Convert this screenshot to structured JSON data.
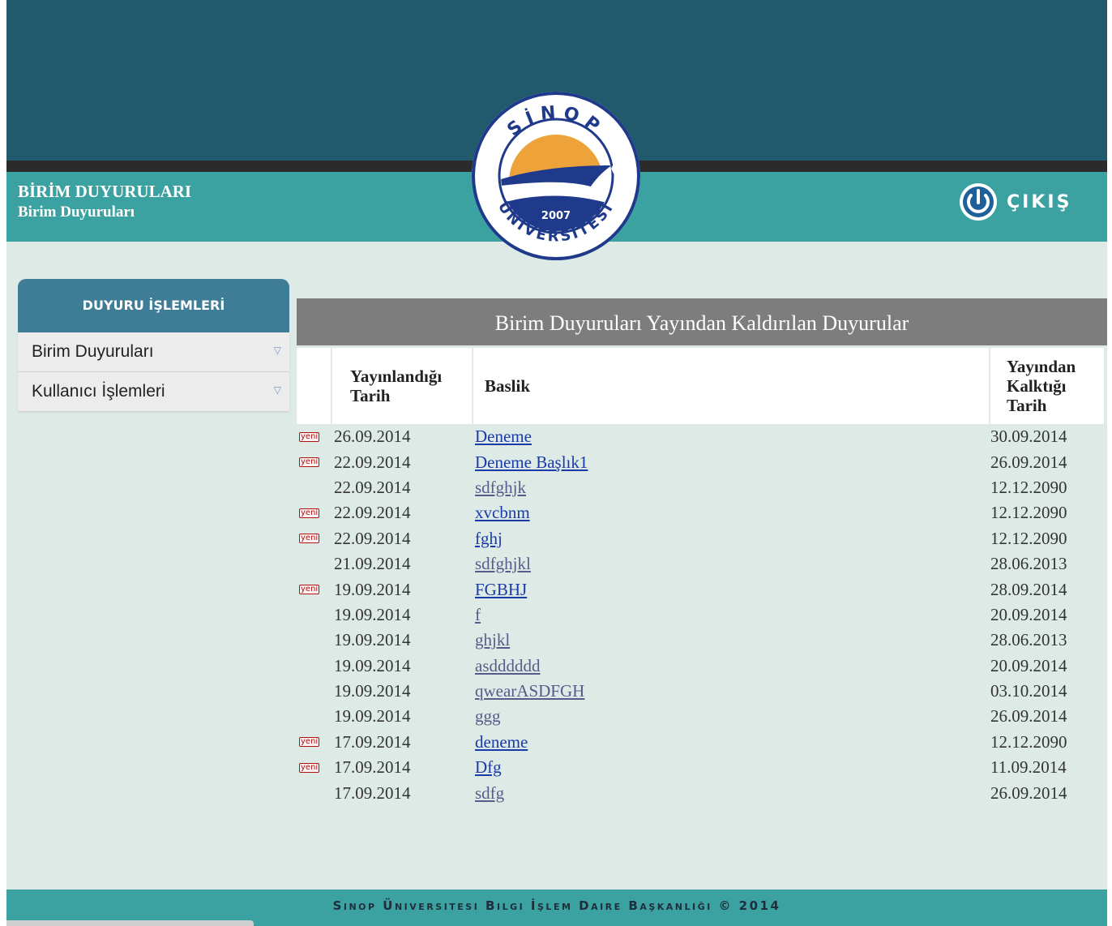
{
  "header": {
    "title": "BİRİM DUYURULARI",
    "subtitle": "Birim Duyuruları",
    "logo": {
      "top_text": "SİNOP",
      "bottom_text": "ÜNİVERSİTESİ",
      "year": "2007"
    },
    "logout_label": "ÇIKIŞ"
  },
  "sidebar": {
    "heading": "DUYURU İŞLEMLERİ",
    "items": [
      {
        "label": "Birim Duyuruları"
      },
      {
        "label": "Kullanıcı İşlemleri"
      }
    ]
  },
  "panel": {
    "title": "Birim Duyuruları Yayından Kaldırılan Duyurular",
    "columns": {
      "published": "Yayınlandığı Tarih",
      "title": "Baslik",
      "removed": "Yayından Kalktığı Tarih"
    },
    "badge_label": "yeni",
    "rows": [
      {
        "new": true,
        "published": "26.09.2014",
        "title": "Deneme",
        "removed": "30.09.2014"
      },
      {
        "new": true,
        "published": "22.09.2014",
        "title": "Deneme Başlık1",
        "removed": "26.09.2014"
      },
      {
        "new": false,
        "published": "22.09.2014",
        "title": "sdfghjk",
        "removed": "12.12.2090"
      },
      {
        "new": true,
        "published": "22.09.2014",
        "title": "xvcbnm",
        "removed": "12.12.2090"
      },
      {
        "new": true,
        "published": "22.09.2014",
        "title": "fghj",
        "removed": "12.12.2090"
      },
      {
        "new": false,
        "published": "21.09.2014",
        "title": "sdfghjkl",
        "removed": "28.06.2013"
      },
      {
        "new": true,
        "published": "19.09.2014",
        "title": "FGBHJ",
        "removed": "28.09.2014"
      },
      {
        "new": false,
        "published": "19.09.2014",
        "title": "f",
        "removed": "20.09.2014"
      },
      {
        "new": false,
        "published": "19.09.2014",
        "title": "ghjkl",
        "removed": "28.06.2013"
      },
      {
        "new": false,
        "published": "19.09.2014",
        "title": "asdddddd",
        "removed": "20.09.2014"
      },
      {
        "new": false,
        "published": "19.09.2014",
        "title": "qwearASDFGH",
        "removed": "03.10.2014"
      },
      {
        "new": false,
        "published": "19.09.2014",
        "title": "ggg",
        "removed": "26.09.2014"
      },
      {
        "new": true,
        "published": "17.09.2014",
        "title": "deneme",
        "removed": "12.12.2090"
      },
      {
        "new": true,
        "published": "17.09.2014",
        "title": "Dfg",
        "removed": "11.09.2014"
      },
      {
        "new": false,
        "published": "17.09.2014",
        "title": "sdfg",
        "removed": "26.09.2014"
      }
    ]
  },
  "footer": {
    "text": "Sinop Üniversitesi Bilgi İşlem Daire Başkanlığı © 2014"
  },
  "colors": {
    "header_band": "#215a6c",
    "teal": "#3ba1a1",
    "sidebar_head": "#3f7d96",
    "panel_head": "#7d7d7d",
    "page_bg": "#ddeae6",
    "logo_orange": "#eea33a",
    "logo_navy": "#1f3a8a"
  }
}
